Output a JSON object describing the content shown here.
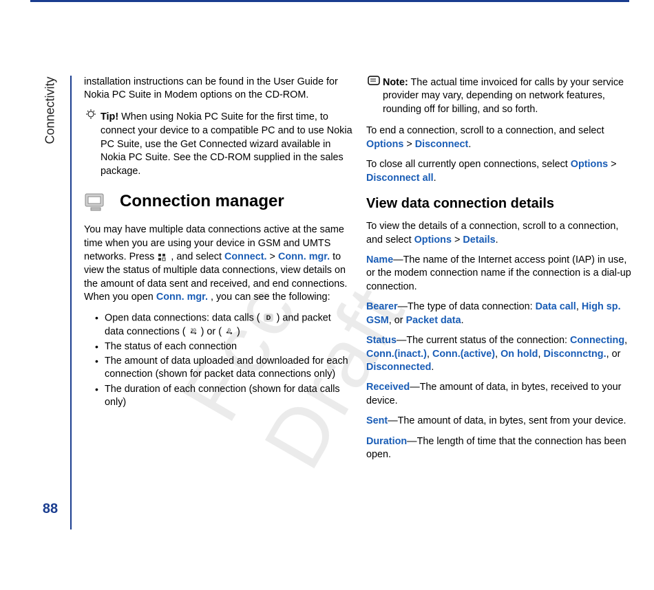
{
  "sidebar": {
    "title": "Connectivity",
    "page": "88"
  },
  "watermark": "Fcc Draft",
  "col1": {
    "p1": "installation instructions can be found in the User Guide for Nokia PC Suite in Modem options on the CD-ROM.",
    "tip_label": "Tip!",
    "tip_body": " When using Nokia PC Suite for the first time, to connect your device to a compatible PC and to use Nokia PC Suite, use the Get Connected wizard available in Nokia PC Suite. See the CD-ROM supplied in the sales package.",
    "section_title": "Connection manager",
    "p2a": "You may have multiple data connections active at the same time when you are using your device in GSM and UMTS networks. Press ",
    "p2b": " , and select ",
    "connect": "Connect.",
    "gt": " > ",
    "connmgr": "Conn. mgr.",
    "p2c": " to view the status of multiple data connections, view details on the amount of data sent and received, and end connections. When you open ",
    "connmgr2": "Conn. mgr.",
    "p2d": ", you can see the following:",
    "li1a": "Open data connections: data calls (",
    "li1b": ") and packet data connections (",
    "li1c": ") or (",
    "li1d": ")",
    "li2": "The status of each connection",
    "li3": "The amount of data uploaded and downloaded for each connection (shown for packet data connections only)",
    "li4": "The duration of each connection (shown for data calls only)"
  },
  "col2": {
    "note_label": "Note:",
    "note_body": " The actual time invoiced for calls by your service provider may vary, depending on network features, rounding off for billing, and so forth.",
    "p3a": "To end a connection, scroll to a connection, and select ",
    "options": "Options",
    "gt": " > ",
    "disconnect": "Disconnect",
    "p3b": ".",
    "p4a": "To close all currently open connections, select ",
    "options2": "Options",
    "disconnect_all": "Disconnect all",
    "p4b": ".",
    "sub_title": "View data connection details",
    "p5a": "To view the details of a connection, scroll to a connection, and select ",
    "options3": "Options",
    "details": "Details",
    "p5b": ".",
    "name_label": "Name",
    "name_body": "—The name of the Internet access point (IAP) in use, or the modem connection name if the connection is a dial-up connection.",
    "bearer_label": "Bearer",
    "bearer_a": "—The type of data connection: ",
    "datacall": "Data call",
    "comma": ", ",
    "highsp": "High sp. GSM",
    "or": ", or ",
    "packet": "Packet data",
    "bearer_b": ".",
    "status_label": "Status",
    "status_a": "—The current status of the connection: ",
    "connecting": "Connecting",
    "conninact": "Conn.(inact.)",
    "connactive": "Conn.(active)",
    "onhold": "On hold",
    "disconnctng": "Disconnctng.",
    "disconnected": "Disconnected",
    "status_b": ".",
    "recv_label": "Received",
    "recv_body": "—The amount of data, in bytes, received to your device.",
    "sent_label": "Sent",
    "sent_body": "—The amount of data, in bytes, sent from your device.",
    "dur_label": "Duration",
    "dur_body": "—The length of time that the connection has been open."
  }
}
